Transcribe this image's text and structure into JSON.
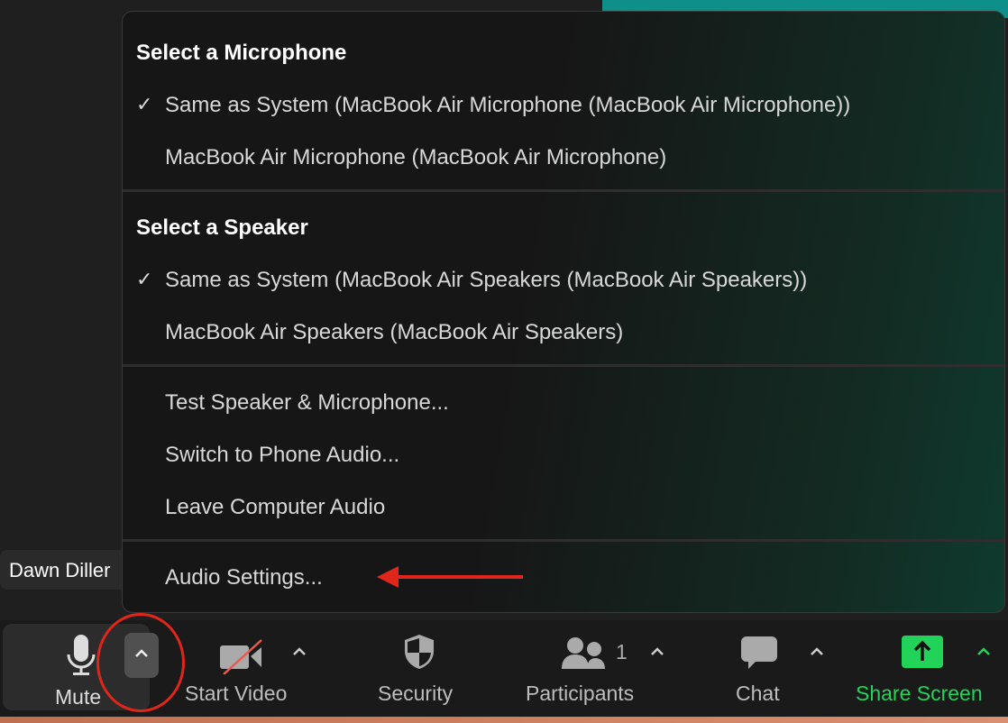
{
  "participant_name": "Dawn Diller",
  "menu": {
    "microphone_header": "Select a Microphone",
    "microphones": [
      {
        "label": "Same as System (MacBook Air Microphone (MacBook Air Microphone))",
        "checked": true
      },
      {
        "label": "MacBook Air Microphone (MacBook Air Microphone)",
        "checked": false
      }
    ],
    "speaker_header": "Select a Speaker",
    "speakers": [
      {
        "label": "Same as System (MacBook Air Speakers (MacBook Air Speakers))",
        "checked": true
      },
      {
        "label": "MacBook Air Speakers (MacBook Air Speakers)",
        "checked": false
      }
    ],
    "actions": [
      "Test Speaker & Microphone...",
      "Switch to Phone Audio...",
      "Leave Computer Audio"
    ],
    "settings": "Audio Settings...",
    "check_glyph": "✓"
  },
  "toolbar": {
    "mute": "Mute",
    "start_video": "Start Video",
    "security": "Security",
    "participants": "Participants",
    "participant_count": "1",
    "chat": "Chat",
    "share_screen": "Share Screen"
  },
  "colors": {
    "share_green": "#22d35a",
    "annotation_red": "#e0261a"
  }
}
